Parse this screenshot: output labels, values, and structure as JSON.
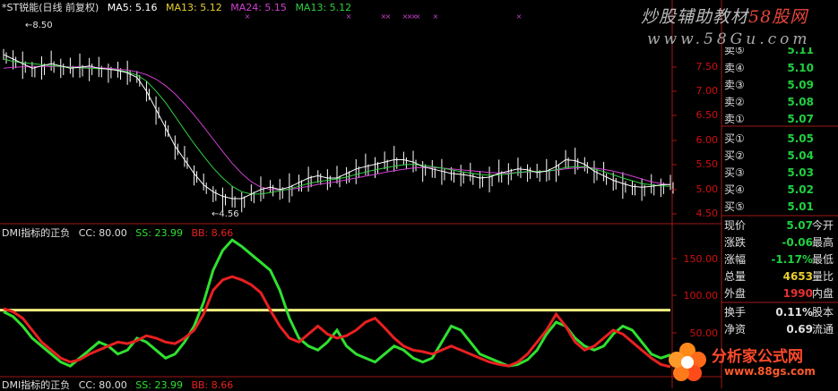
{
  "header": {
    "title": "*ST锐能(日线 前复权)",
    "ma5": "MA5: 5.16",
    "ma13": "MA13: 5.12",
    "ma24": "MA24: 5.15",
    "ma13b": "MA13: 5.12"
  },
  "indicator_header": {
    "name": "DMI指标的正负",
    "cc": "CC: 80.00",
    "ss": "SS: 23.99",
    "bb": "BB: 8.66"
  },
  "bottom_header": {
    "name": "DMI指标的正负",
    "cc": "CC: 80.00",
    "ss": "SS: 23.99",
    "bb": "BB: 8.66"
  },
  "price_axis": [
    "7.50",
    "7.00",
    "6.50",
    "6.00",
    "5.50",
    "5.00",
    "4.50"
  ],
  "indicator_axis": [
    "150.00",
    "100.00",
    "50.00"
  ],
  "annotations": {
    "high": "8.50",
    "low": "4.56"
  },
  "order_book": {
    "sell": [
      {
        "label": "卖⑤",
        "price": "5.11"
      },
      {
        "label": "卖④",
        "price": "5.10"
      },
      {
        "label": "卖③",
        "price": "5.09"
      },
      {
        "label": "卖②",
        "price": "5.08"
      },
      {
        "label": "卖①",
        "price": "5.07"
      }
    ],
    "buy": [
      {
        "label": "买①",
        "price": "5.05"
      },
      {
        "label": "买②",
        "price": "5.04"
      },
      {
        "label": "买③",
        "price": "5.03"
      },
      {
        "label": "买④",
        "price": "5.02"
      },
      {
        "label": "买⑤",
        "price": "5.01"
      }
    ]
  },
  "quote": [
    {
      "label": "现价",
      "value": "5.07",
      "color": "#20d040",
      "label2": "今开"
    },
    {
      "label": "涨跌",
      "value": "-0.06",
      "color": "#20d040",
      "label2": "最高"
    },
    {
      "label": "涨幅",
      "value": "-1.17%",
      "color": "#20d040",
      "label2": "最低"
    },
    {
      "label": "总量",
      "value": "4653",
      "color": "#e8d030",
      "label2": "量比"
    },
    {
      "label": "外盘",
      "value": "1990",
      "color": "#e83030",
      "label2": "内盘"
    },
    {
      "label": "换手",
      "value": "0.11%",
      "color": "#e0e0e0",
      "label2": "股本"
    },
    {
      "label": "净资",
      "value": "0.69",
      "color": "#e0e0e0",
      "label2": "流通"
    }
  ],
  "watermarks": {
    "top": "炒股辅助教材",
    "top_brand": "58股网",
    "url": "www.58Gu.com",
    "bottom_name": "分析家公式网",
    "bottom_url": "www.88gs.com"
  },
  "colors": {
    "ma5": "#ffffff",
    "ma13": "#e8d030",
    "ma24": "#d040d0",
    "ma13b": "#30d040",
    "ss": "#30e030",
    "bb": "#e82020",
    "cc": "#f0f080"
  },
  "chart_data": {
    "type": "line",
    "price_ylim": [
      4.4,
      8.8
    ],
    "indicator_ylim": [
      0,
      175
    ],
    "cc_level": 80,
    "ma5_series": [
      8.0,
      7.9,
      7.8,
      7.7,
      7.75,
      7.8,
      7.75,
      7.7,
      7.72,
      7.75,
      7.7,
      7.68,
      7.65,
      7.6,
      7.5,
      7.2,
      6.8,
      6.4,
      6.0,
      5.7,
      5.4,
      5.15,
      5.0,
      4.9,
      4.85,
      4.85,
      4.95,
      5.05,
      5.1,
      5.05,
      5.1,
      5.2,
      5.3,
      5.35,
      5.3,
      5.3,
      5.4,
      5.5,
      5.55,
      5.6,
      5.65,
      5.7,
      5.7,
      5.65,
      5.55,
      5.5,
      5.45,
      5.4,
      5.38,
      5.35,
      5.3,
      5.32,
      5.4,
      5.45,
      5.5,
      5.48,
      5.42,
      5.45,
      5.55,
      5.7,
      5.68,
      5.6,
      5.45,
      5.35,
      5.25,
      5.18,
      5.12,
      5.1,
      5.12,
      5.15,
      5.16
    ],
    "ma13_series": [
      7.9,
      7.85,
      7.82,
      7.8,
      7.78,
      7.76,
      7.74,
      7.72,
      7.71,
      7.7,
      7.69,
      7.68,
      7.66,
      7.62,
      7.55,
      7.42,
      7.2,
      6.95,
      6.65,
      6.35,
      6.05,
      5.78,
      5.52,
      5.3,
      5.12,
      5.0,
      4.95,
      4.95,
      4.98,
      5.02,
      5.06,
      5.12,
      5.18,
      5.22,
      5.25,
      5.28,
      5.32,
      5.38,
      5.43,
      5.48,
      5.52,
      5.56,
      5.59,
      5.6,
      5.58,
      5.55,
      5.52,
      5.48,
      5.44,
      5.41,
      5.38,
      5.36,
      5.37,
      5.39,
      5.42,
      5.44,
      5.44,
      5.45,
      5.48,
      5.53,
      5.55,
      5.55,
      5.5,
      5.44,
      5.37,
      5.3,
      5.24,
      5.18,
      5.15,
      5.13,
      5.12
    ],
    "ma24_series": [
      7.7,
      7.72,
      7.73,
      7.74,
      7.74,
      7.74,
      7.74,
      7.73,
      7.73,
      7.72,
      7.71,
      7.7,
      7.68,
      7.66,
      7.62,
      7.56,
      7.46,
      7.32,
      7.14,
      6.92,
      6.68,
      6.42,
      6.15,
      5.88,
      5.62,
      5.4,
      5.22,
      5.1,
      5.05,
      5.04,
      5.05,
      5.08,
      5.12,
      5.16,
      5.19,
      5.22,
      5.26,
      5.3,
      5.34,
      5.38,
      5.42,
      5.46,
      5.49,
      5.52,
      5.53,
      5.53,
      5.52,
      5.5,
      5.48,
      5.46,
      5.44,
      5.42,
      5.41,
      5.41,
      5.42,
      5.43,
      5.44,
      5.45,
      5.47,
      5.5,
      5.52,
      5.53,
      5.52,
      5.49,
      5.45,
      5.4,
      5.34,
      5.28,
      5.22,
      5.18,
      5.15
    ],
    "ss_series": [
      78,
      72,
      60,
      45,
      35,
      25,
      15,
      10,
      20,
      30,
      40,
      35,
      25,
      30,
      45,
      40,
      30,
      20,
      25,
      40,
      60,
      90,
      130,
      155,
      168,
      160,
      150,
      140,
      130,
      105,
      70,
      45,
      35,
      30,
      40,
      55,
      35,
      25,
      20,
      15,
      25,
      35,
      30,
      20,
      15,
      20,
      40,
      60,
      55,
      40,
      25,
      20,
      15,
      10,
      12,
      18,
      30,
      50,
      65,
      60,
      45,
      35,
      30,
      35,
      50,
      60,
      55,
      40,
      25,
      20,
      24
    ],
    "bb_series": [
      82,
      78,
      70,
      55,
      40,
      30,
      20,
      15,
      18,
      25,
      30,
      35,
      40,
      38,
      42,
      48,
      45,
      40,
      38,
      45,
      55,
      75,
      105,
      118,
      122,
      118,
      112,
      102,
      80,
      60,
      45,
      40,
      50,
      60,
      50,
      45,
      48,
      55,
      65,
      70,
      58,
      45,
      35,
      30,
      28,
      25,
      30,
      35,
      30,
      25,
      20,
      15,
      12,
      10,
      15,
      25,
      40,
      55,
      75,
      60,
      40,
      30,
      35,
      45,
      55,
      50,
      40,
      30,
      20,
      12,
      9
    ]
  }
}
